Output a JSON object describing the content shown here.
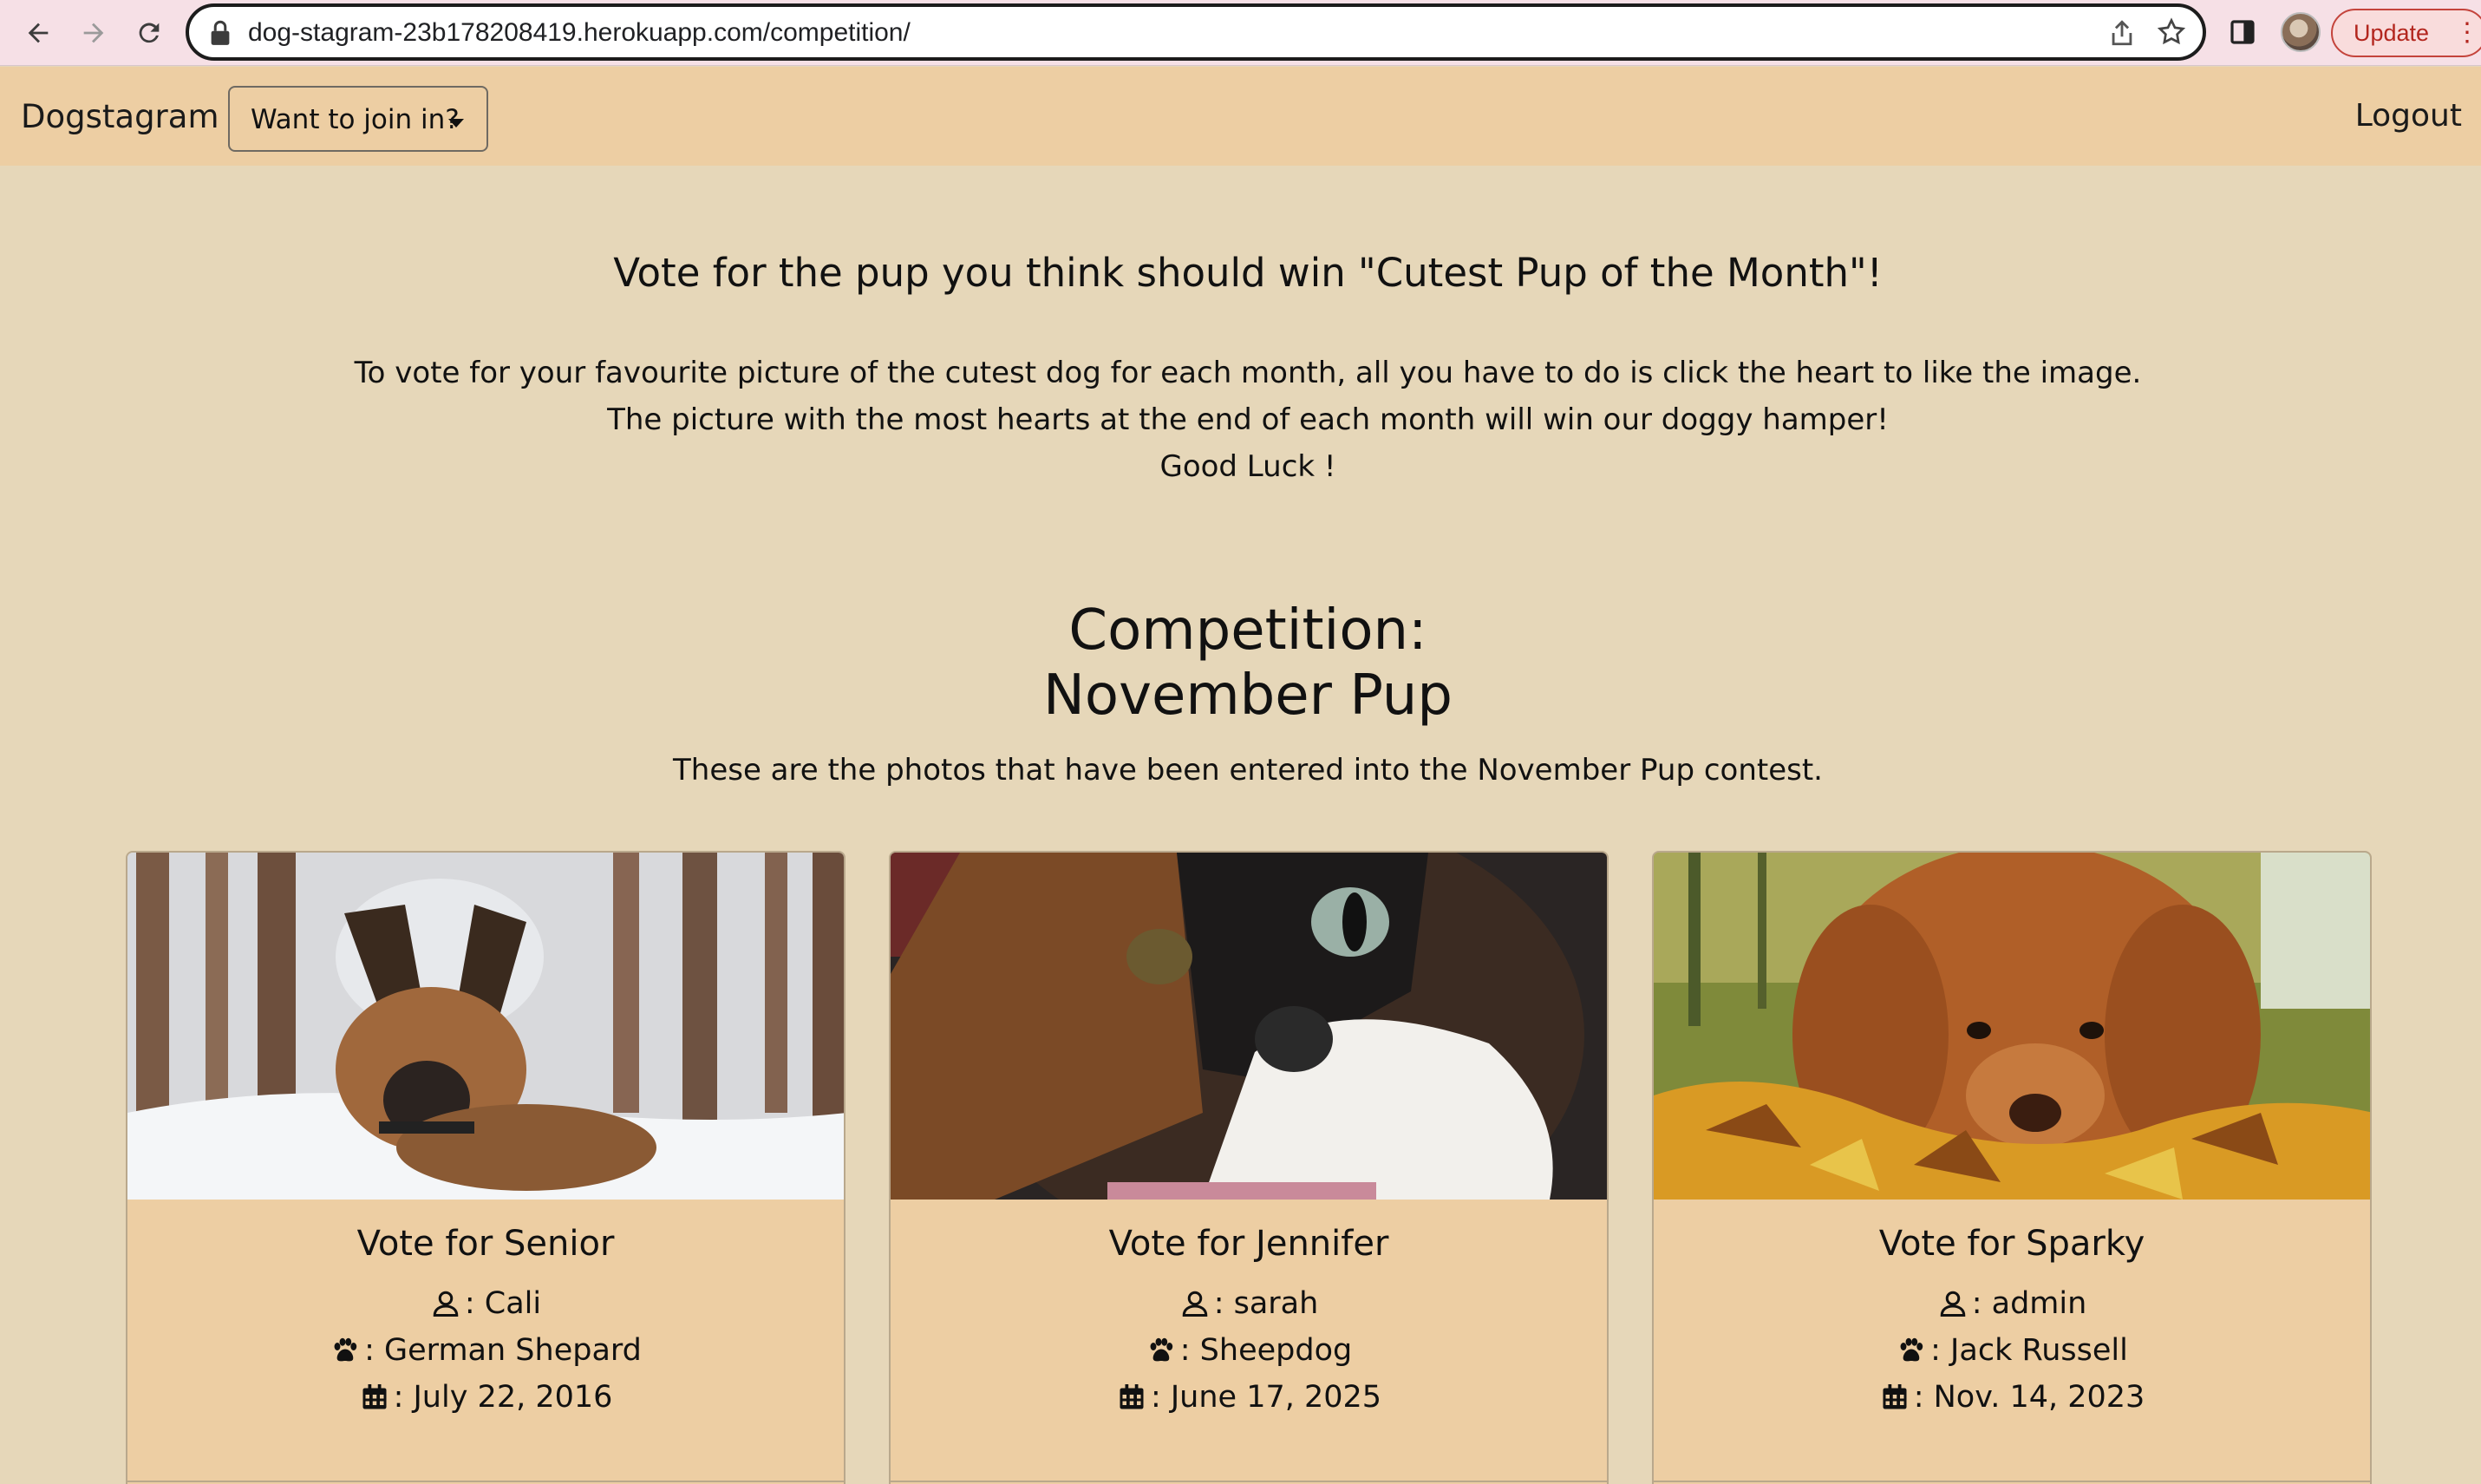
{
  "browser": {
    "url": "dog-stagram-23b178208419.herokuapp.com/competition/",
    "update_label": "Update"
  },
  "navbar": {
    "brand": "Dogstagram",
    "dropdown_label": "Want to join in?",
    "logout_label": "Logout"
  },
  "intro": {
    "title": "Vote for the pup you think should win \"Cutest Pup of the Month\"!",
    "lines": [
      "To vote for your favourite picture of the cutest dog for each month, all you have to do is click the heart to like the image.",
      "The picture with the most hearts at the end of each month will win our doggy hamper!",
      "Good Luck !"
    ]
  },
  "competition": {
    "heading_line1": "Competition:",
    "heading_line2": "November Pup",
    "subtitle": "These are the photos that have been entered into the November Pup contest."
  },
  "cards": [
    {
      "title": "Vote for Senior",
      "owner": ": Cali",
      "breed": ": German Shepard",
      "date": ": July 22, 2016",
      "photo": "german-shepherd-in-snow"
    },
    {
      "title": "Vote for Jennifer",
      "owner": ": sarah",
      "breed": ": Sheepdog",
      "date": ": June 17, 2025",
      "photo": "calico-cat-closeup"
    },
    {
      "title": "Vote for Sparky",
      "owner": ": admin",
      "breed": ": Jack Russell",
      "date": ": Nov. 14, 2023",
      "photo": "golden-dog-in-leaves"
    }
  ],
  "icons": {
    "owner": "user-icon",
    "breed": "paw-icon",
    "date": "calendar-icon"
  }
}
